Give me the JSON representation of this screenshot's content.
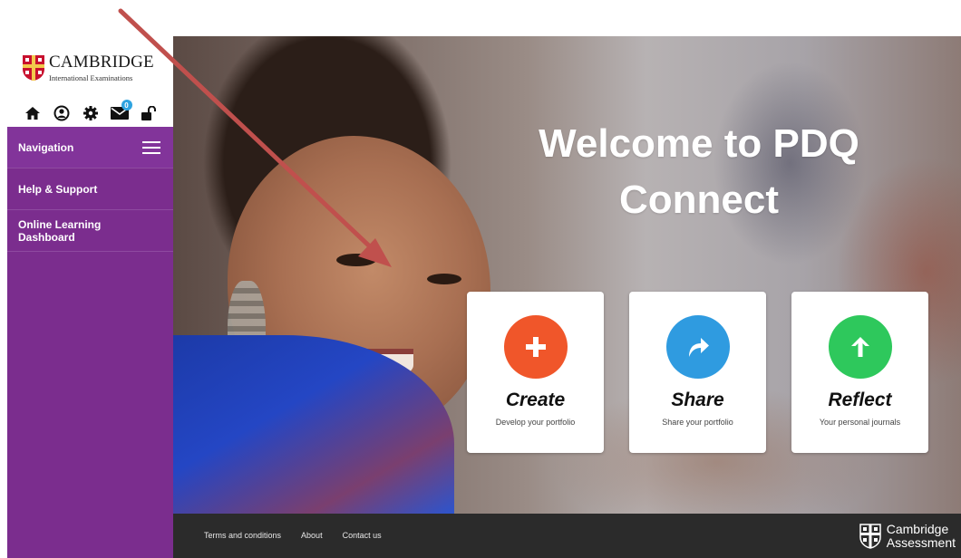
{
  "brand": {
    "name": "CAMBRIDGE",
    "subtitle": "International Examinations"
  },
  "toolbar": {
    "icons": [
      "home-icon",
      "user-icon",
      "gear-icon",
      "mail-icon",
      "unlock-icon"
    ],
    "mail_badge": "0"
  },
  "sidebar": {
    "items": [
      {
        "label": "Navigation"
      },
      {
        "label": "Help & Support"
      },
      {
        "label": "Online Learning Dashboard"
      }
    ]
  },
  "hero": {
    "title_line1": "Welcome to PDQ",
    "title_line2": "Connect"
  },
  "cards": [
    {
      "title": "Create",
      "subtitle": "Develop your portfolio",
      "color": "#f0562a",
      "icon": "plus-icon"
    },
    {
      "title": "Share",
      "subtitle": "Share your portfolio",
      "color": "#2f9be0",
      "icon": "share-arrow-icon"
    },
    {
      "title": "Reflect",
      "subtitle": "Your personal journals",
      "color": "#2ec85c",
      "icon": "up-arrow-icon"
    }
  ],
  "footer": {
    "links": [
      "Terms and conditions",
      "About",
      "Contact us"
    ],
    "logo_line1": "Cambridge",
    "logo_line2": "Assessment"
  },
  "colors": {
    "sidebar": "#7b2d8e",
    "footer": "#2b2b2b",
    "annotation_arrow": "#c0504d"
  }
}
